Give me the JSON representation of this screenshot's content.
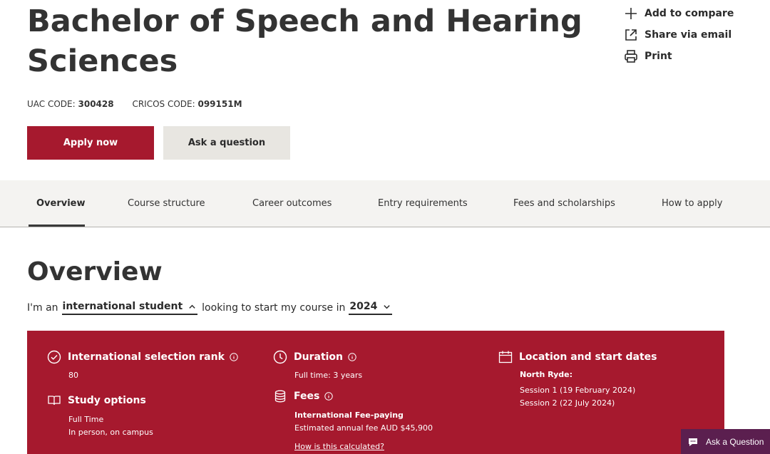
{
  "page": {
    "title": "Bachelor of Speech and Hearing Sciences"
  },
  "actions": {
    "compare_label": "Add to compare",
    "share_label": "Share via email",
    "print_label": "Print"
  },
  "codes": {
    "uac_label": "UAC CODE:",
    "uac_value": "300428",
    "cricos_label": "CRICOS CODE:",
    "cricos_value": "099151M"
  },
  "buttons": {
    "apply_label": "Apply now",
    "ask_label": "Ask a question"
  },
  "tabs": [
    {
      "label": "Overview",
      "active": true
    },
    {
      "label": "Course structure"
    },
    {
      "label": "Career outcomes"
    },
    {
      "label": "Entry requirements"
    },
    {
      "label": "Fees and scholarships"
    },
    {
      "label": "How to apply"
    }
  ],
  "overview": {
    "heading": "Overview",
    "prefix": "I'm an",
    "student_type": "international student",
    "middle": "looking to start my course in",
    "year": "2024"
  },
  "panel": {
    "rank": {
      "title": "International selection rank",
      "value": "80"
    },
    "study": {
      "title": "Study options",
      "line1": "Full Time",
      "line2": "In person, on campus"
    },
    "duration": {
      "title": "Duration",
      "value": "Full time: 3 years"
    },
    "fees": {
      "title": "Fees",
      "type": "International Fee-paying",
      "estimate": "Estimated annual fee AUD $45,900",
      "link": "How is this calculated?"
    },
    "location": {
      "title": "Location and start dates",
      "campus": "North Ryde:",
      "session1": "Session 1 (19 February 2024)",
      "session2": "Session 2 (22 July 2024)"
    }
  },
  "chat": {
    "label": "Ask a Question"
  },
  "colors": {
    "brand_red": "#a6192e",
    "chat_purple": "#5b1f4f",
    "tab_bg": "#f4f3f1"
  },
  "icons": [
    "plus-icon",
    "share-icon",
    "print-icon",
    "check-circle-icon",
    "clock-icon",
    "info-icon",
    "book-icon",
    "coins-icon",
    "calendar-icon",
    "chevron-up-icon",
    "chevron-down-icon",
    "chat-icon"
  ]
}
